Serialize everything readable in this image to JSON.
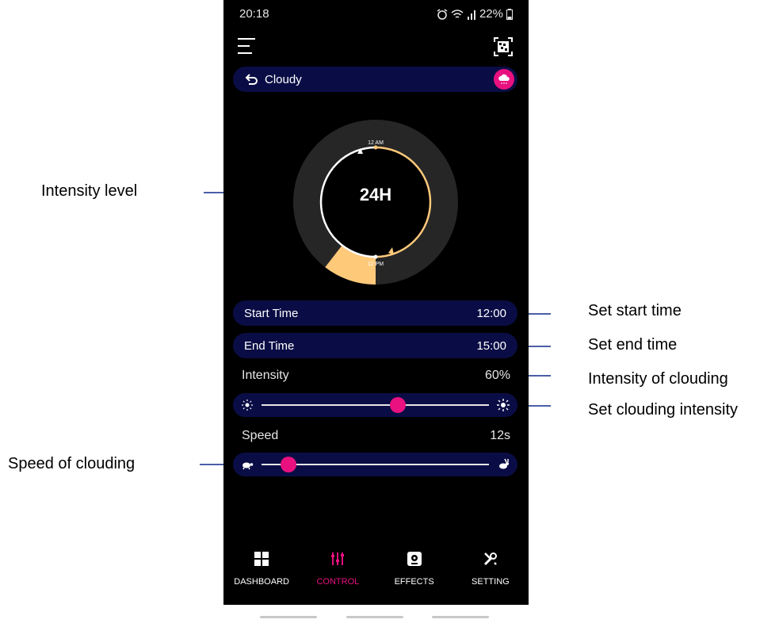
{
  "status_bar": {
    "time": "20:18",
    "battery": "22%"
  },
  "header": {
    "title": "Cloudy"
  },
  "dial": {
    "center": "24H",
    "top_label": "12 AM",
    "bottom_label": "12 PM",
    "intensity_level": 0.35
  },
  "start_time": {
    "label": "Start Time",
    "value": "12:00"
  },
  "end_time": {
    "label": "End Time",
    "value": "15:00"
  },
  "intensity": {
    "label": "Intensity",
    "value": "60%",
    "slider_value": 0.6
  },
  "speed": {
    "label": "Speed",
    "value": "12s",
    "slider_value": 0.12
  },
  "nav": [
    {
      "label": "DASHBOARD",
      "icon": "grid-icon"
    },
    {
      "label": "CONTROL",
      "icon": "sliders-icon",
      "active": true
    },
    {
      "label": "EFFECTS",
      "icon": "effects-icon"
    },
    {
      "label": "SETTING",
      "icon": "tools-icon"
    }
  ],
  "annotations": {
    "intensity_level": "Intensity level",
    "set_start_time": "Set start time",
    "set_end_time": "Set end time",
    "intensity_of_clouding": "Intensity of clouding",
    "set_clouding_intensity": "Set clouding intensity",
    "speed_of_clouding": "Speed of clouding"
  },
  "colors": {
    "accent": "#e8117f",
    "pill_bg": "#0a0d45",
    "ring_highlight": "#ffc97a",
    "annotation_line": "#4b5ea8"
  }
}
